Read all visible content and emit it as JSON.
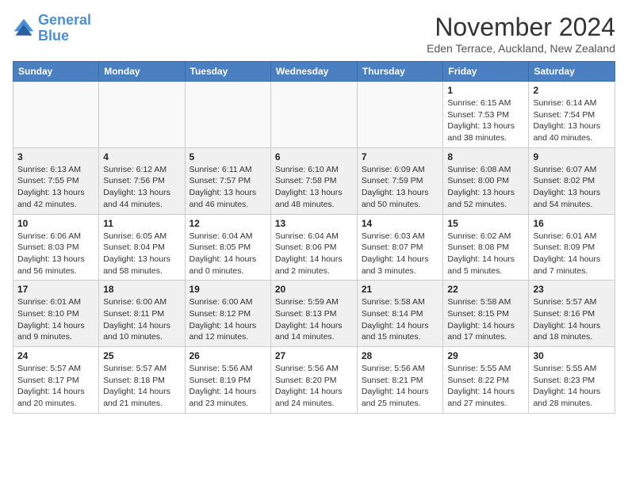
{
  "logo": {
    "line1": "General",
    "line2": "Blue"
  },
  "title": "November 2024",
  "location": "Eden Terrace, Auckland, New Zealand",
  "days_of_week": [
    "Sunday",
    "Monday",
    "Tuesday",
    "Wednesday",
    "Thursday",
    "Friday",
    "Saturday"
  ],
  "weeks": [
    [
      {
        "day": "",
        "info": ""
      },
      {
        "day": "",
        "info": ""
      },
      {
        "day": "",
        "info": ""
      },
      {
        "day": "",
        "info": ""
      },
      {
        "day": "",
        "info": ""
      },
      {
        "day": "1",
        "info": "Sunrise: 6:15 AM\nSunset: 7:53 PM\nDaylight: 13 hours\nand 38 minutes."
      },
      {
        "day": "2",
        "info": "Sunrise: 6:14 AM\nSunset: 7:54 PM\nDaylight: 13 hours\nand 40 minutes."
      }
    ],
    [
      {
        "day": "3",
        "info": "Sunrise: 6:13 AM\nSunset: 7:55 PM\nDaylight: 13 hours\nand 42 minutes."
      },
      {
        "day": "4",
        "info": "Sunrise: 6:12 AM\nSunset: 7:56 PM\nDaylight: 13 hours\nand 44 minutes."
      },
      {
        "day": "5",
        "info": "Sunrise: 6:11 AM\nSunset: 7:57 PM\nDaylight: 13 hours\nand 46 minutes."
      },
      {
        "day": "6",
        "info": "Sunrise: 6:10 AM\nSunset: 7:58 PM\nDaylight: 13 hours\nand 48 minutes."
      },
      {
        "day": "7",
        "info": "Sunrise: 6:09 AM\nSunset: 7:59 PM\nDaylight: 13 hours\nand 50 minutes."
      },
      {
        "day": "8",
        "info": "Sunrise: 6:08 AM\nSunset: 8:00 PM\nDaylight: 13 hours\nand 52 minutes."
      },
      {
        "day": "9",
        "info": "Sunrise: 6:07 AM\nSunset: 8:02 PM\nDaylight: 13 hours\nand 54 minutes."
      }
    ],
    [
      {
        "day": "10",
        "info": "Sunrise: 6:06 AM\nSunset: 8:03 PM\nDaylight: 13 hours\nand 56 minutes."
      },
      {
        "day": "11",
        "info": "Sunrise: 6:05 AM\nSunset: 8:04 PM\nDaylight: 13 hours\nand 58 minutes."
      },
      {
        "day": "12",
        "info": "Sunrise: 6:04 AM\nSunset: 8:05 PM\nDaylight: 14 hours\nand 0 minutes."
      },
      {
        "day": "13",
        "info": "Sunrise: 6:04 AM\nSunset: 8:06 PM\nDaylight: 14 hours\nand 2 minutes."
      },
      {
        "day": "14",
        "info": "Sunrise: 6:03 AM\nSunset: 8:07 PM\nDaylight: 14 hours\nand 3 minutes."
      },
      {
        "day": "15",
        "info": "Sunrise: 6:02 AM\nSunset: 8:08 PM\nDaylight: 14 hours\nand 5 minutes."
      },
      {
        "day": "16",
        "info": "Sunrise: 6:01 AM\nSunset: 8:09 PM\nDaylight: 14 hours\nand 7 minutes."
      }
    ],
    [
      {
        "day": "17",
        "info": "Sunrise: 6:01 AM\nSunset: 8:10 PM\nDaylight: 14 hours\nand 9 minutes."
      },
      {
        "day": "18",
        "info": "Sunrise: 6:00 AM\nSunset: 8:11 PM\nDaylight: 14 hours\nand 10 minutes."
      },
      {
        "day": "19",
        "info": "Sunrise: 6:00 AM\nSunset: 8:12 PM\nDaylight: 14 hours\nand 12 minutes."
      },
      {
        "day": "20",
        "info": "Sunrise: 5:59 AM\nSunset: 8:13 PM\nDaylight: 14 hours\nand 14 minutes."
      },
      {
        "day": "21",
        "info": "Sunrise: 5:58 AM\nSunset: 8:14 PM\nDaylight: 14 hours\nand 15 minutes."
      },
      {
        "day": "22",
        "info": "Sunrise: 5:58 AM\nSunset: 8:15 PM\nDaylight: 14 hours\nand 17 minutes."
      },
      {
        "day": "23",
        "info": "Sunrise: 5:57 AM\nSunset: 8:16 PM\nDaylight: 14 hours\nand 18 minutes."
      }
    ],
    [
      {
        "day": "24",
        "info": "Sunrise: 5:57 AM\nSunset: 8:17 PM\nDaylight: 14 hours\nand 20 minutes."
      },
      {
        "day": "25",
        "info": "Sunrise: 5:57 AM\nSunset: 8:18 PM\nDaylight: 14 hours\nand 21 minutes."
      },
      {
        "day": "26",
        "info": "Sunrise: 5:56 AM\nSunset: 8:19 PM\nDaylight: 14 hours\nand 23 minutes."
      },
      {
        "day": "27",
        "info": "Sunrise: 5:56 AM\nSunset: 8:20 PM\nDaylight: 14 hours\nand 24 minutes."
      },
      {
        "day": "28",
        "info": "Sunrise: 5:56 AM\nSunset: 8:21 PM\nDaylight: 14 hours\nand 25 minutes."
      },
      {
        "day": "29",
        "info": "Sunrise: 5:55 AM\nSunset: 8:22 PM\nDaylight: 14 hours\nand 27 minutes."
      },
      {
        "day": "30",
        "info": "Sunrise: 5:55 AM\nSunset: 8:23 PM\nDaylight: 14 hours\nand 28 minutes."
      }
    ]
  ]
}
